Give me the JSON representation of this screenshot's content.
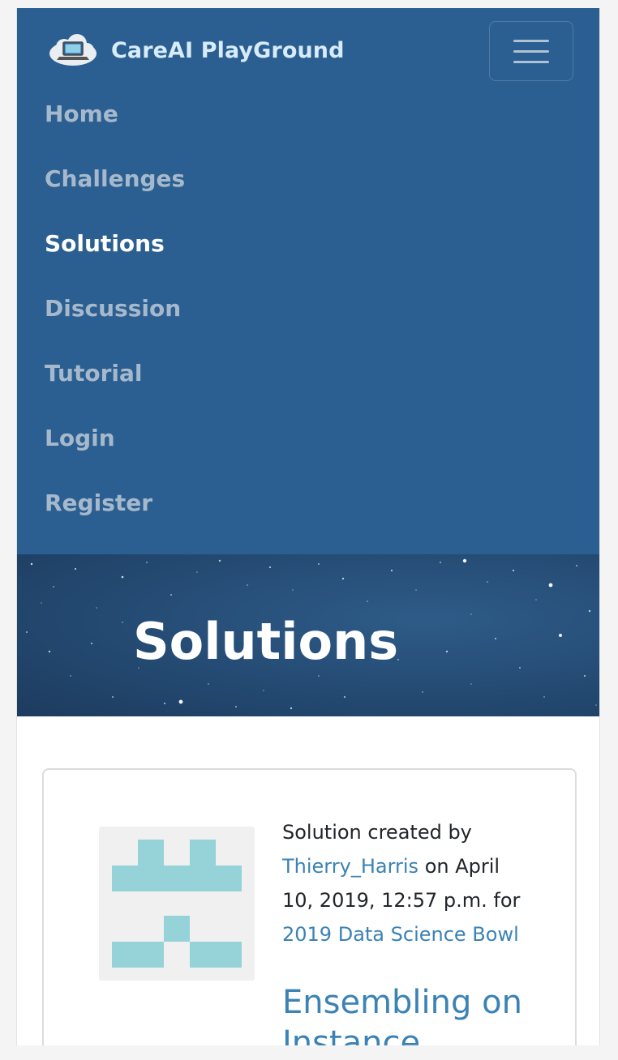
{
  "brand": {
    "name": "CareAI PlayGround",
    "logo_icon": "cloud-laptop-icon"
  },
  "navbar": {
    "toggle_icon": "hamburger-menu-icon",
    "items": [
      {
        "label": "Home",
        "active": false
      },
      {
        "label": "Challenges",
        "active": false
      },
      {
        "label": "Solutions",
        "active": true
      },
      {
        "label": "Discussion",
        "active": false
      },
      {
        "label": "Tutorial",
        "active": false
      },
      {
        "label": "Login",
        "active": false
      },
      {
        "label": "Register",
        "active": false
      }
    ]
  },
  "hero": {
    "title": "Solutions"
  },
  "solution": {
    "prefix": "Solution created by",
    "author": "Thierry_Harris",
    "on_text": "on April 10, 2019, 12:57 p.m. for",
    "challenge": "2019 Data Science Bowl",
    "title": "Ensembling on Instance"
  },
  "colors": {
    "navbar_bg": "#2b5f91",
    "nav_link": "#a6b9cc",
    "nav_active": "#ffffff",
    "link": "#3b82b5",
    "identicon": "#95d3d8"
  }
}
